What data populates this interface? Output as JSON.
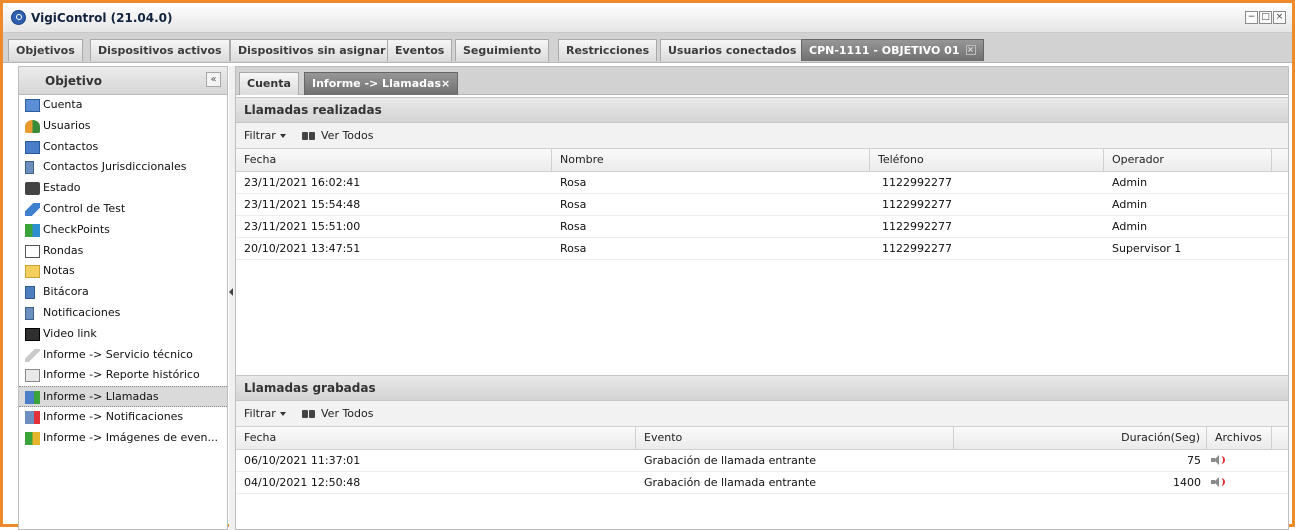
{
  "app": {
    "title": "VigiControl (21.04.0)"
  },
  "window_controls": {
    "minimize": "−",
    "maximize": "□",
    "close": "×"
  },
  "tabs": [
    {
      "label": "Objetivos"
    },
    {
      "label": "Dispositivos activos"
    },
    {
      "label": "Dispositivos sin asignar"
    },
    {
      "label": "Eventos"
    },
    {
      "label": "Seguimiento"
    },
    {
      "label": "Restricciones"
    },
    {
      "label": "Usuarios conectados"
    },
    {
      "label": "CPN-1111 - OBJETIVO 01",
      "active": true,
      "closable": true
    }
  ],
  "sidebar": {
    "title": "Objetivo",
    "collapse_label": "«",
    "items": [
      {
        "label": "Cuenta",
        "icon": "id-card-icon"
      },
      {
        "label": "Usuarios",
        "icon": "users-icon"
      },
      {
        "label": "Contactos",
        "icon": "phone-icon"
      },
      {
        "label": "Contactos Jurisdiccionales",
        "icon": "phone-list-icon"
      },
      {
        "label": "Estado",
        "icon": "binoculars-icon"
      },
      {
        "label": "Control de Test",
        "icon": "feather-icon"
      },
      {
        "label": "CheckPoints",
        "icon": "flags-icon"
      },
      {
        "label": "Rondas",
        "icon": "map-icon"
      },
      {
        "label": "Notas",
        "icon": "note-icon"
      },
      {
        "label": "Bitácora",
        "icon": "logbook-icon"
      },
      {
        "label": "Notificaciones",
        "icon": "notification-icon"
      },
      {
        "label": "Video link",
        "icon": "film-icon"
      },
      {
        "label": "Informe -> Servicio técnico",
        "icon": "wrench-icon"
      },
      {
        "label": "Informe -> Reporte histórico",
        "icon": "report-icon"
      },
      {
        "label": "Informe -> Llamadas",
        "icon": "calls-icon",
        "selected": true
      },
      {
        "label": "Informe -> Notificaciones",
        "icon": "notification-report-icon"
      },
      {
        "label": "Informe -> Imágenes de even...",
        "icon": "images-icon"
      }
    ]
  },
  "subtabs": [
    {
      "label": "Cuenta"
    },
    {
      "label": "Informe -> Llamadas",
      "active": true,
      "closable": true
    }
  ],
  "made_calls": {
    "title": "Llamadas realizadas",
    "filter_label": "Filtrar",
    "view_all_label": "Ver Todos",
    "columns": [
      "Fecha",
      "Nombre",
      "Teléfono",
      "Operador"
    ],
    "rows": [
      [
        "23/11/2021 16:02:41",
        "Rosa",
        "1122992277",
        "Admin"
      ],
      [
        "23/11/2021 15:54:48",
        "Rosa",
        "1122992277",
        "Admin"
      ],
      [
        "23/11/2021 15:51:00",
        "Rosa",
        "1122992277",
        "Admin"
      ],
      [
        "20/10/2021 13:47:51",
        "Rosa",
        "1122992277",
        "Supervisor 1"
      ]
    ]
  },
  "recorded_calls": {
    "title": "Llamadas grabadas",
    "filter_label": "Filtrar",
    "view_all_label": "Ver Todos",
    "columns": [
      "Fecha",
      "Evento",
      "Duración(Seg)",
      "Archivos"
    ],
    "rows": [
      [
        "06/10/2021 11:37:01",
        "Grabación de llamada entrante",
        "75"
      ],
      [
        "04/10/2021 12:50:48",
        "Grabación de llamada entrante",
        "1400"
      ]
    ]
  },
  "colors": {
    "window_border": "#ef8a2c",
    "active_tab": "#7f7f7f",
    "speaker_accent": "#e03030"
  }
}
